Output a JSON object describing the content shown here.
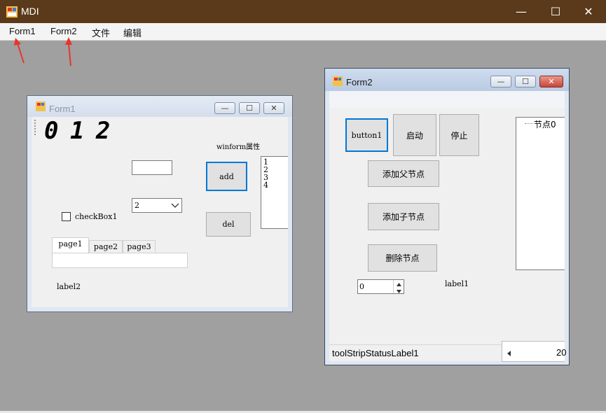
{
  "app": {
    "title": "MDI",
    "controls": {
      "minimize": "—",
      "maximize": "☐",
      "close": "✕"
    }
  },
  "menu": {
    "items": [
      "Form1",
      "Form2",
      "文件",
      "编辑"
    ]
  },
  "form1": {
    "title": "Form1",
    "controls": {
      "minimize": "—",
      "maximize": "☐",
      "close": "✕"
    },
    "led_digits": "0 1 2",
    "textbox_value": "",
    "combo_value": "2",
    "checkbox_label": "checkBox1",
    "checkbox_checked": false,
    "tabs": [
      "page1",
      "page2",
      "page3"
    ],
    "active_tab": 0,
    "label2": "label2",
    "label_winform": "winform属性",
    "add_button": "add",
    "del_button": "del",
    "listbox_items": [
      "1",
      "2",
      "3",
      "4"
    ]
  },
  "form2": {
    "title": "Form2",
    "controls": {
      "minimize": "—",
      "maximize": "☐",
      "close": "✕"
    },
    "button1": "button1",
    "start_button": "启动",
    "stop_button": "停止",
    "add_parent_node": "添加父节点",
    "add_child_node": "添加子节点",
    "delete_node": "删除节点",
    "numeric_value": "0",
    "label1": "label1",
    "tree_nodes": [
      "节点0"
    ],
    "status_label": "toolStripStatusLabel1",
    "trackbar_text": "20"
  },
  "colors": {
    "titlebar": "#5a3a1a",
    "mdi_background": "#a0a0a0",
    "focus_border": "#0078d7",
    "close_button": "#c9443a",
    "arrow": "#e8352a"
  }
}
